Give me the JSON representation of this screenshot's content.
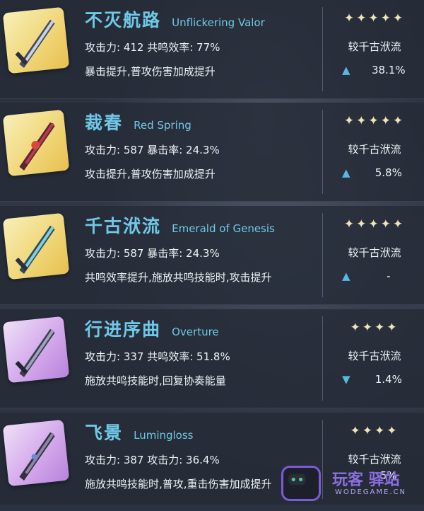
{
  "weapons": [
    {
      "name_cn": "不灭航路",
      "name_en": "Unflickering Valor",
      "stats": "攻击力: 412  共鸣效率: 77%",
      "effect": "暴击提升,普攻伤害加成提升",
      "stars": "✦✦✦✦✦",
      "compare_label": "较千古洑流",
      "arrow": "▲",
      "diff": "38.1%",
      "rarity": "gold"
    },
    {
      "name_cn": "裁春",
      "name_en": "Red Spring",
      "stats": "攻击力: 587  暴击率: 24.3%",
      "effect": "攻击提升,普攻伤害加成提升",
      "stars": "✦✦✦✦✦",
      "compare_label": "较千古洑流",
      "arrow": "▲",
      "diff": "5.8%",
      "rarity": "gold"
    },
    {
      "name_cn": "千古洑流",
      "name_en": "Emerald of Genesis",
      "stats": "攻击力: 587  暴击率: 24.3%",
      "effect": "共鸣效率提升,施放共鸣技能时,攻击提升",
      "stars": "✦✦✦✦✦",
      "compare_label": "较千古洑流",
      "arrow": "▲",
      "diff": "-",
      "rarity": "gold"
    },
    {
      "name_cn": "行进序曲",
      "name_en": "Overture",
      "stats": "攻击力: 337  共鸣效率: 51.8%",
      "effect": "施放共鸣技能时,回复协奏能量",
      "stars": "✦✦✦✦",
      "compare_label": "较千古洑流",
      "arrow": "▼",
      "diff": "1.4%",
      "rarity": "purple"
    },
    {
      "name_cn": "飞景",
      "name_en": "Lumingloss",
      "stats": "攻击力: 387  攻击力: 36.4%",
      "effect": "施放共鸣技能时,普攻,重击伤害加成提升",
      "stars": "✦✦✦✦",
      "compare_label": "较千古洑流",
      "arrow": "",
      "diff": "5%",
      "rarity": "purple"
    }
  ],
  "watermark": {
    "text": "玩客 驿站",
    "url": "WODEGAME.CN"
  },
  "colors": {
    "title": "#6fc8e6",
    "arrow": "#58b8e2",
    "gold": "#f0d77a",
    "purple": "#d4a9ec"
  }
}
